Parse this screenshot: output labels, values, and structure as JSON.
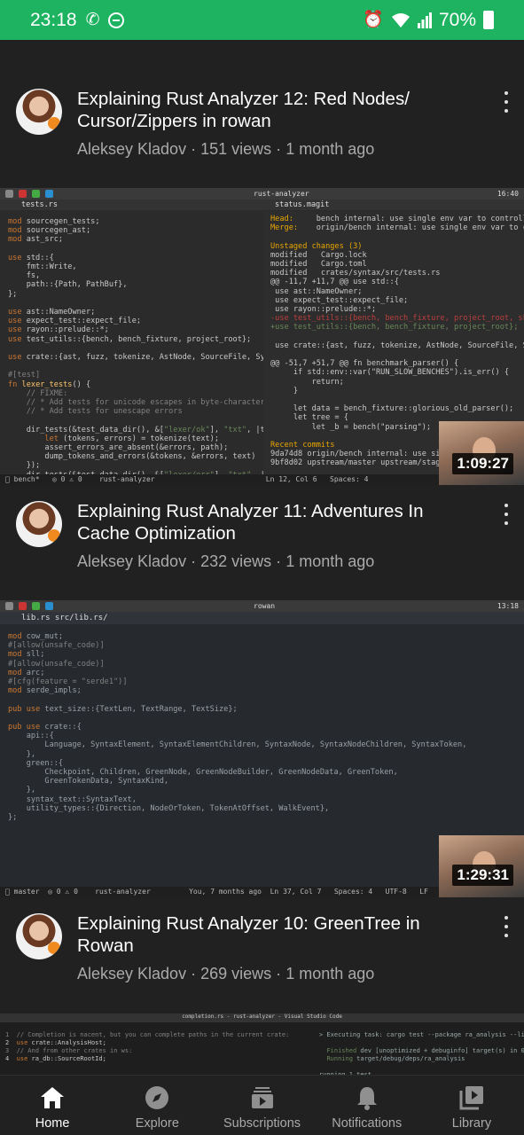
{
  "status_bar": {
    "time": "23:18",
    "battery": "70%"
  },
  "videos": [
    {
      "title": "Explaining Rust Analyzer 12: Red Nodes/ Cursor/Zippers in rowan",
      "channel": "Aleksey Kladov",
      "views": "151 views",
      "age": "1 month ago",
      "duration": "1:09:27",
      "thumb_window_title": "rust-analyzer",
      "thumb_tab_left": "tests.rs",
      "thumb_tab_right": "status.magit",
      "thumb_clock": "16:40"
    },
    {
      "title": "Explaining Rust Analyzer 11: Adventures In Cache Optimization",
      "channel": "Aleksey Kladov",
      "views": "232 views",
      "age": "1 month ago",
      "duration": "1:29:31",
      "thumb_window_title": "rowan",
      "thumb_tab_left": "lib.rs  src/lib.rs/",
      "thumb_clock": "13:18"
    },
    {
      "title": "Explaining Rust Analyzer 10: GreenTree in Rowan",
      "channel": "Aleksey Kladov",
      "views": "269 views",
      "age": "1 month ago",
      "thumb_window_title": "completion.rs - rust-analyzer - Visual Studio Code"
    }
  ],
  "separator": "·",
  "bottom_nav": [
    {
      "label": "Home",
      "icon": "home-icon",
      "active": true
    },
    {
      "label": "Explore",
      "icon": "compass-icon",
      "active": false
    },
    {
      "label": "Subscriptions",
      "icon": "subscriptions-icon",
      "active": false
    },
    {
      "label": "Notifications",
      "icon": "bell-icon",
      "active": false
    },
    {
      "label": "Library",
      "icon": "library-icon",
      "active": false
    }
  ],
  "colors": {
    "status_bar": "#1db360",
    "background": "#212121",
    "secondary_text": "#aaaaaa"
  }
}
